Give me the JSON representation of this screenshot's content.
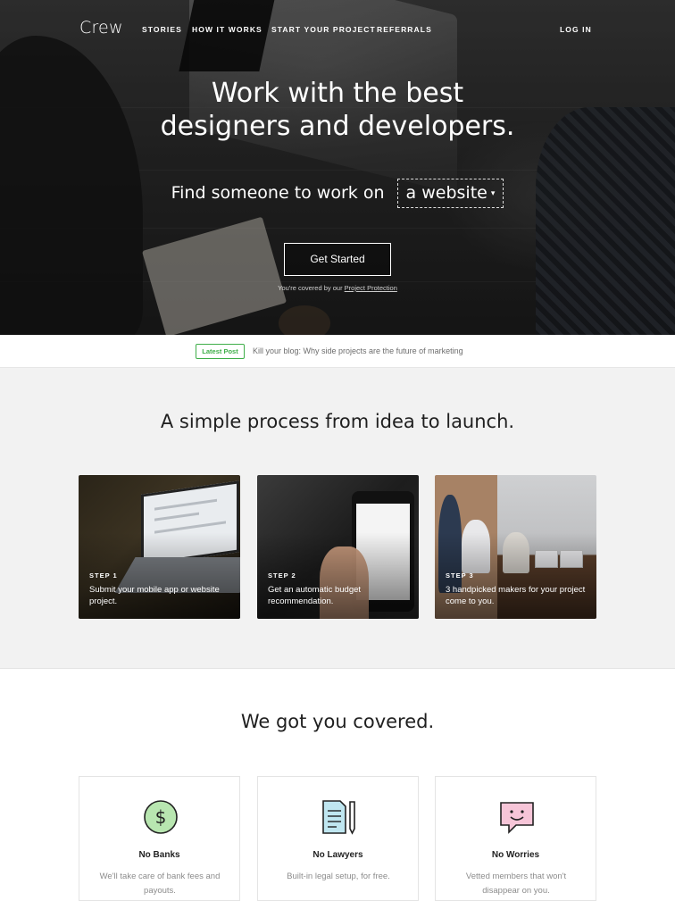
{
  "nav": {
    "logo": "Crew",
    "links": [
      "STORIES",
      "HOW IT WORKS",
      "START YOUR PROJECT",
      "REFERRALS"
    ],
    "login": "LOG IN"
  },
  "hero": {
    "title_line1": "Work with the best",
    "title_line2": "designers and developers.",
    "find_prefix": "Find someone to work on",
    "find_selected": "a website",
    "cta": "Get Started",
    "covered_prefix": "You're covered by our",
    "covered_link": "Project Protection"
  },
  "latest": {
    "badge": "Latest Post",
    "text": "Kill your blog: Why side projects are the future of marketing",
    "badge_color": "#3fae49"
  },
  "process": {
    "title": "A simple process from idea to launch.",
    "steps": [
      {
        "label": "STEP 1",
        "text": "Submit your mobile app or website project."
      },
      {
        "label": "STEP 2",
        "text": "Get an automatic budget recommendation."
      },
      {
        "label": "STEP 3",
        "text": "3 handpicked makers for your project come to you."
      }
    ]
  },
  "covered": {
    "title": "We got you covered.",
    "features": [
      {
        "icon": "dollar-icon",
        "title": "No Banks",
        "text": "We'll take care of bank fees and payouts."
      },
      {
        "icon": "document-icon",
        "title": "No Lawyers",
        "text": "Built-in legal setup, for free."
      },
      {
        "icon": "smile-chat-icon",
        "title": "No Worries",
        "text": "Vetted members that won't disappear on you."
      }
    ]
  }
}
